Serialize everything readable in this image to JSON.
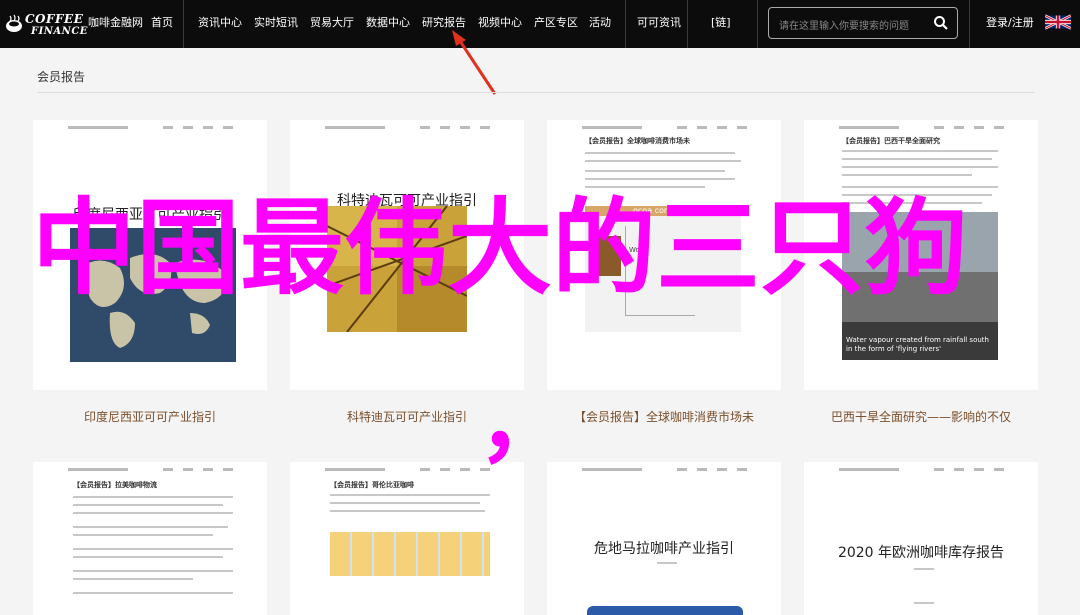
{
  "nav": {
    "logo_line1": "COFFEE",
    "logo_line2": "FINANCE",
    "items": [
      "咖啡金融网",
      "首页",
      "资讯中心",
      "实时短讯",
      "贸易大厅",
      "数据中心",
      "研究报告",
      "视频中心",
      "产区专区",
      "活动",
      "可可资讯",
      "[链]"
    ],
    "search_placeholder": "请在这里输入你要搜索的问题",
    "login": "登录/注册"
  },
  "section": {
    "title": "会员报告"
  },
  "overlay": {
    "text": "中国最伟大的三只狗",
    "comma": "，"
  },
  "cards": [
    {
      "doc_title": "印度尼西亚可可产业指引",
      "caption": "印度尼西亚可可产业指引"
    },
    {
      "doc_title": "科特迪瓦可可产业指引",
      "caption": "科特迪瓦可可产业指引"
    },
    {
      "doc_title": "【会员报告】全球咖啡消费市场未",
      "caption": "【会员报告】全球咖啡消费市场未",
      "chart_note": "ocoa consumption",
      "chart_label": "World"
    },
    {
      "doc_title": "【会员报告】巴西干旱全面研究",
      "caption": "巴西干旱全面研究——影响的不仅",
      "photo_text": "Water vapour created from rainfall south in the form of 'flying rivers'"
    },
    {
      "doc_title": "【会员报告】拉美咖啡物流"
    },
    {
      "doc_title": "【会员报告】哥伦比亚咖啡"
    },
    {
      "doc_title": "危地马拉咖啡产业指引"
    },
    {
      "doc_title": "2020 年欧洲咖啡库存报告"
    }
  ],
  "colors": {
    "nav_bg": "#0c0c0c",
    "overlay": "#ff00ff",
    "caption": "#7a4f2c",
    "arrow": "#e0301e"
  }
}
